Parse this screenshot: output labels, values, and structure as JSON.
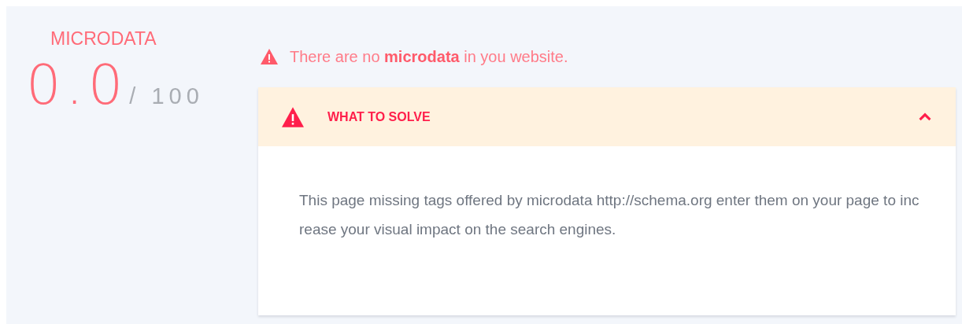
{
  "score": {
    "label": "MICRODATA",
    "value": "0.0",
    "max": "/ 100"
  },
  "alert": {
    "message": "There are no **microdata** in you website."
  },
  "panel": {
    "title": "WHAT TO SOLVE",
    "expanded": true,
    "body": "This page missing tags offered by microdata http://schema.org enter them on your page to increase your visual impact on the search engines."
  }
}
